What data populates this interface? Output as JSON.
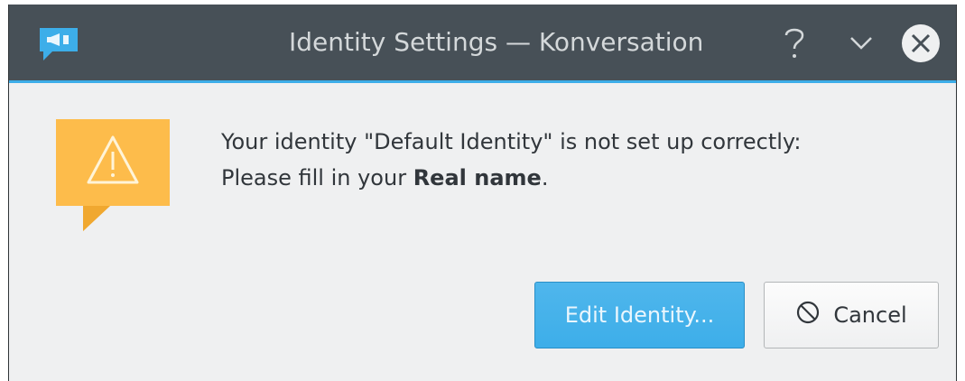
{
  "window": {
    "title": "Identity Settings — Konversation"
  },
  "titlebar": {
    "app_icon": "konversation-icon",
    "help_icon": "help-icon",
    "minimize_icon": "chevron-down-icon",
    "close_icon": "close-icon"
  },
  "dialog": {
    "icon": "warning-icon",
    "message_line1": "Your identity \"Default Identity\" is not set up correctly:",
    "message_line2_prefix": "Please fill in your ",
    "message_line2_bold": "Real name",
    "message_line2_suffix": "."
  },
  "buttons": {
    "edit_label": "Edit Identity...",
    "cancel_label": "Cancel",
    "cancel_icon": "cancel-icon"
  },
  "colors": {
    "titlebar": "#475057",
    "accent": "#3daee9",
    "warning": "#fdbc4b",
    "background": "#eff0f1"
  }
}
